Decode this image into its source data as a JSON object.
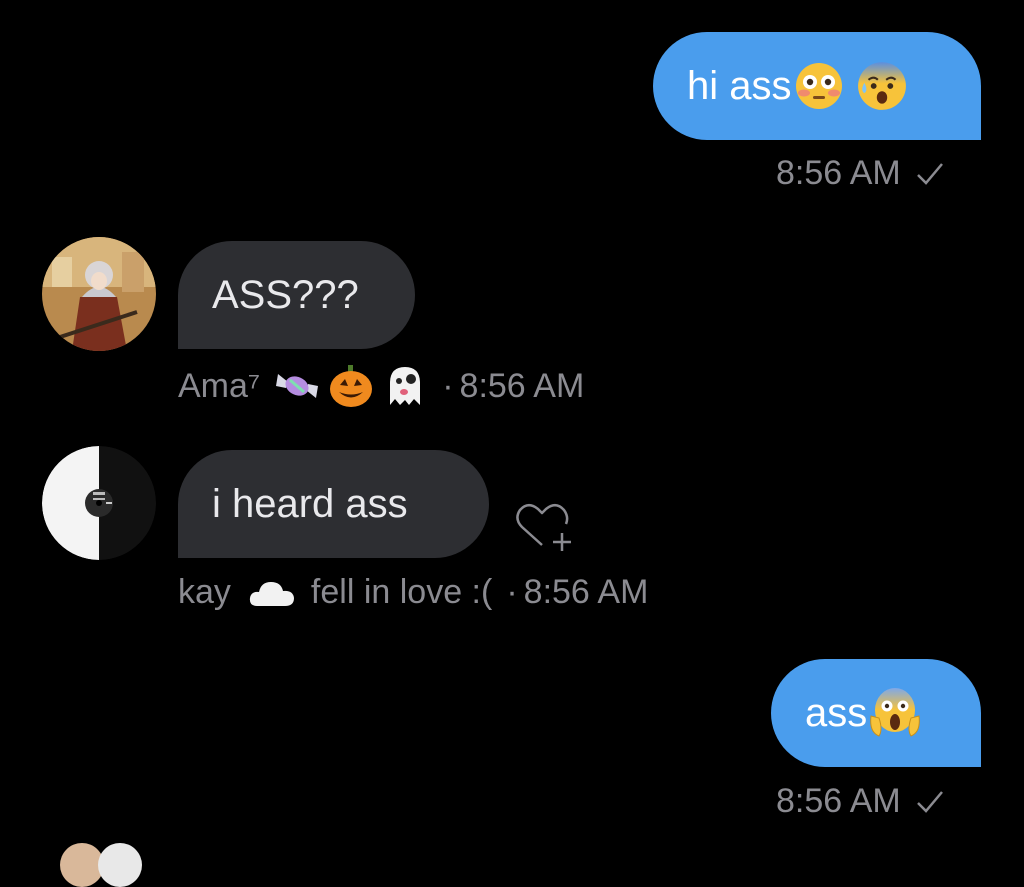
{
  "colors": {
    "background": "#000000",
    "outgoing_bubble": "#4a9ded",
    "incoming_bubble": "#2d2e32",
    "meta_text": "#8b8b91"
  },
  "messages": [
    {
      "direction": "outgoing",
      "text": "hi ass",
      "emojis": [
        "flushed-face",
        "anxious-face-with-sweat"
      ],
      "time": "8:56 AM",
      "status_icon": "checkmark-icon"
    },
    {
      "direction": "incoming",
      "text": "ASS???",
      "sender": "Ama⁷",
      "sender_emojis": [
        "candy",
        "jack-o-lantern",
        "ghost"
      ],
      "separator": "·",
      "time": "8:56 AM",
      "avatar": "anime-character-avatar"
    },
    {
      "direction": "incoming",
      "text": "i heard ass",
      "sender": "kay",
      "sender_emoji": "cloud",
      "sender_suffix": "fell in love :(",
      "separator": "·",
      "time": "8:56 AM",
      "avatar": "vinyl-record-avatar",
      "reaction_button": "heart-plus-icon"
    },
    {
      "direction": "outgoing",
      "text": "ass",
      "emojis": [
        "face-screaming-in-fear"
      ],
      "time": "8:56 AM",
      "status_icon": "checkmark-icon"
    }
  ]
}
